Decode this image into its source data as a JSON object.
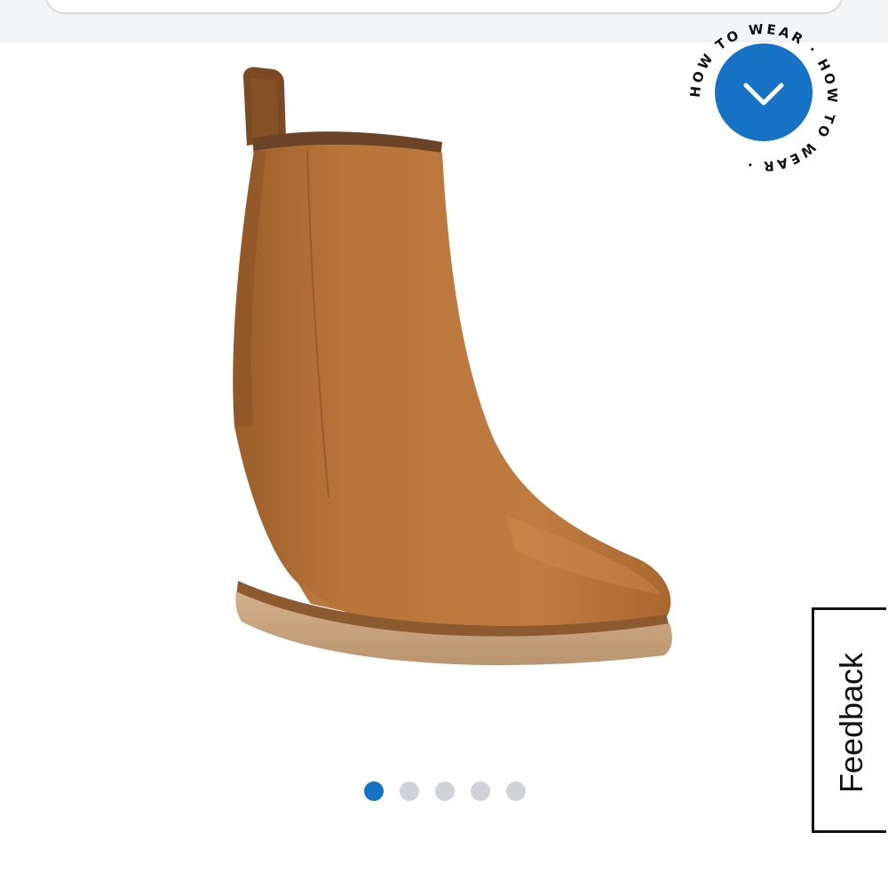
{
  "search": {
    "placeholder": ""
  },
  "product": {
    "image_alt": "Brown suede wedge ankle boot",
    "colors": {
      "suede": "#b8753a",
      "suede_shade": "#a0622c",
      "sole": "#c9a683",
      "welt": "#8d5a30"
    }
  },
  "how_to_wear": {
    "ring_text": "HOW TO WEAR · HOW TO WEAR ·",
    "button_color": "#1672c4",
    "icon": "chevron-down-icon"
  },
  "carousel": {
    "dots": [
      {
        "index": 1,
        "active": true
      },
      {
        "index": 2,
        "active": false
      },
      {
        "index": 3,
        "active": false
      },
      {
        "index": 4,
        "active": false
      },
      {
        "index": 5,
        "active": false
      }
    ],
    "active_color": "#1672c4",
    "inactive_color": "#cfd3d7"
  },
  "feedback": {
    "label": "Feedback"
  }
}
